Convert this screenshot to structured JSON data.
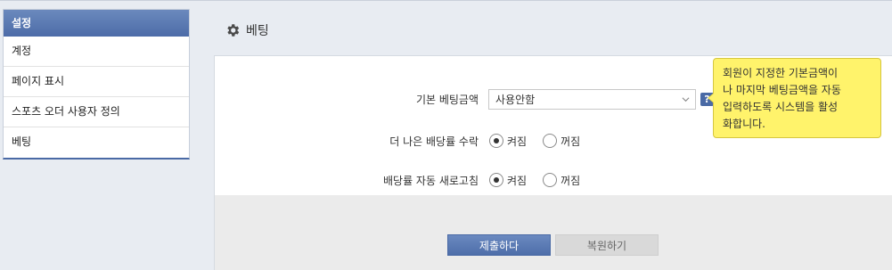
{
  "sidebar": {
    "header": "설정",
    "items": [
      {
        "label": "계정"
      },
      {
        "label": "페이지 표시"
      },
      {
        "label": "스포츠 오더 사용자 정의"
      },
      {
        "label": "베팅"
      }
    ]
  },
  "page": {
    "title": "베팅",
    "title_icon": "gear-icon"
  },
  "form": {
    "default_bet": {
      "label": "기본 베팅금액",
      "value": "사용안함",
      "help": "?"
    },
    "better_odds": {
      "label": "더 나은 배당률 수락",
      "options": [
        "켜짐",
        "꺼짐"
      ],
      "selected": "켜짐"
    },
    "auto_refresh": {
      "label": "배당률 자동 새로고침",
      "options": [
        "켜짐",
        "꺼짐"
      ],
      "selected": "켜짐"
    }
  },
  "tooltip": {
    "lines": [
      "회원이 지정한 기본금액이",
      "나 마지막 베팅금액을 자동",
      "입력하도록 시스템을 활성",
      "화합니다."
    ]
  },
  "buttons": {
    "submit": "제출하다",
    "reset": "복원하기"
  },
  "colors": {
    "accent": "#4a6aa5",
    "tooltip_bg": "#fff36b"
  }
}
